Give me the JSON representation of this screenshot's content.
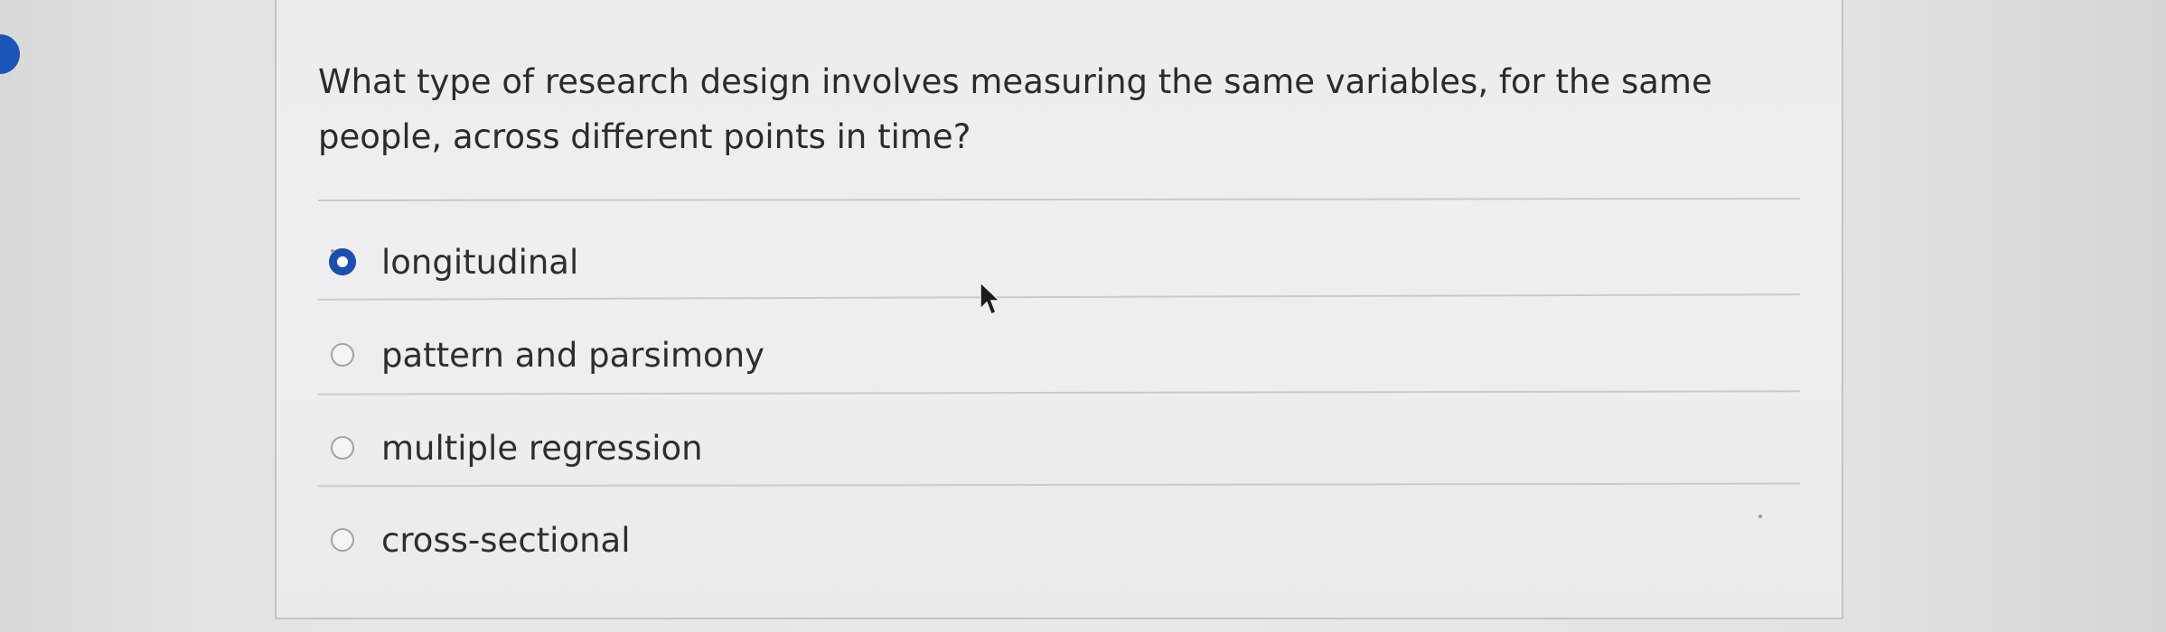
{
  "question": {
    "text": "What type of research design involves measuring the same variables, for the same people, across different points in time?"
  },
  "options": [
    {
      "label": "longitudinal",
      "selected": true
    },
    {
      "label": "pattern and parsimony",
      "selected": false
    },
    {
      "label": "multiple regression",
      "selected": false
    },
    {
      "label": "cross-sectional",
      "selected": false
    }
  ],
  "colors": {
    "selected_radio": "#1a4fae",
    "text": "#2b2b2b",
    "card_background": "#eeeeef"
  },
  "icons": {
    "pointer": "mouse-pointer-icon"
  }
}
